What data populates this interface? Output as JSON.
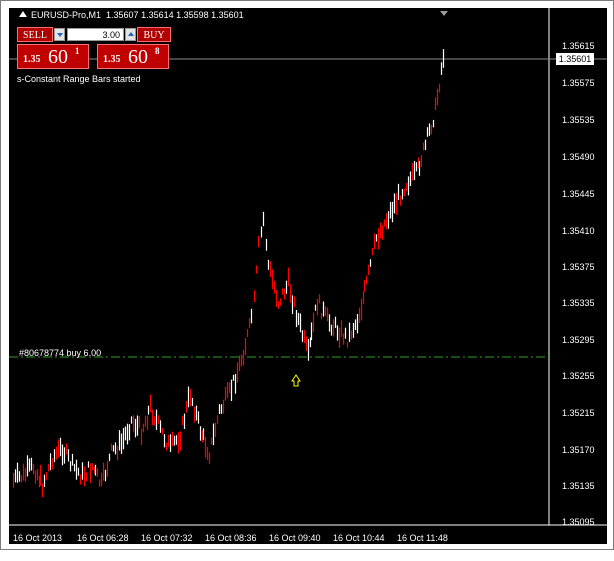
{
  "header": {
    "symbol": "EURUSD-Pro,M1",
    "ohlc": "1.35607 1.35614 1.35598 1.35601"
  },
  "trade_panel": {
    "sell_label": "SELL",
    "buy_label": "BUY",
    "volume": "3.00",
    "sell_price": {
      "prefix": "1.35",
      "big": "60",
      "sup": "1"
    },
    "buy_price": {
      "prefix": "1.35",
      "big": "60",
      "sup": "8"
    }
  },
  "status_message": "s-Constant Range Bars started",
  "order_line": {
    "label": "#80678774 buy 6.00",
    "price": 1.3528
  },
  "current_price": "1.35601",
  "y_axis": {
    "ticks": [
      "1.35615",
      "1.35575",
      "1.35535",
      "1.35490",
      "1.35445",
      "1.35410",
      "1.35375",
      "1.35335",
      "1.35295",
      "1.35255",
      "1.35215",
      "1.35170",
      "1.35135",
      "1.35095"
    ]
  },
  "x_axis": {
    "ticks": [
      "16 Oct 2013",
      "16 Oct 06:28",
      "16 Oct 07:32",
      "16 Oct 08:36",
      "16 Oct 09:40",
      "16 Oct 10:44",
      "16 Oct 11:48"
    ]
  },
  "colors": {
    "background": "#000000",
    "bar_up": "#ffffff",
    "bar_down": "#ff0000",
    "order_line": "#2e9e2e",
    "arrow": "#ffff00"
  },
  "chart_data": {
    "type": "line",
    "title": "EURUSD-Pro,M1",
    "xlabel": "",
    "ylabel": "",
    "ylim": [
      1.35085,
      1.35645
    ],
    "x": [
      0,
      10,
      20,
      30,
      40,
      50,
      60,
      70,
      80,
      90,
      100,
      110,
      120,
      130,
      140,
      150,
      160,
      170,
      180,
      190,
      200,
      210,
      220,
      230,
      240,
      245,
      250,
      255,
      260,
      270,
      280,
      290,
      300,
      310,
      320,
      330,
      340,
      350,
      360,
      370,
      380,
      390,
      400,
      410,
      420,
      430,
      440
    ],
    "series": [
      {
        "values": [
          1.35135,
          1.3514,
          1.3515,
          1.3513,
          1.3516,
          1.3517,
          1.3515,
          1.3514,
          1.3515,
          1.3513,
          1.35165,
          1.35175,
          1.352,
          1.3519,
          1.35215,
          1.3519,
          1.3517,
          1.35185,
          1.3523,
          1.3519,
          1.35165,
          1.3521,
          1.3523,
          1.3526,
          1.353,
          1.3533,
          1.3539,
          1.3542,
          1.3537,
          1.3533,
          1.3535,
          1.3531,
          1.3527,
          1.3533,
          1.3531,
          1.353,
          1.3529,
          1.3531,
          1.3535,
          1.354,
          1.3542,
          1.3544,
          1.3546,
          1.3547,
          1.355,
          1.3554,
          1.35615
        ]
      }
    ]
  }
}
